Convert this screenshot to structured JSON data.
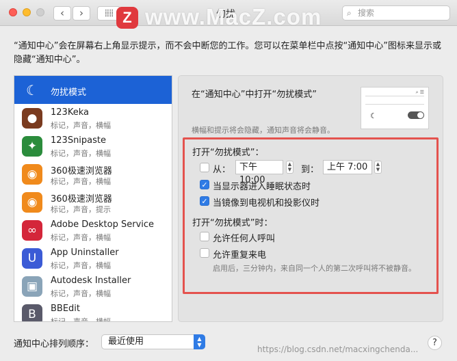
{
  "window": {
    "title": "勿扰"
  },
  "toolbar": {
    "back_icon": "chevron-left-icon",
    "forward_icon": "chevron-right-icon",
    "grid_icon": "show-all-grid-icon"
  },
  "search": {
    "placeholder": "搜索"
  },
  "watermark": {
    "logo_letter": "Z",
    "site": "www.MacZ.com",
    "url": "https://blog.csdn.net/macxingchenda..."
  },
  "description": "“通知中心”会在屏幕右上角显示提示，而不会中断您的工作。您可以在菜单栏中点按“通知中心”图标来显示或隐藏“通知中心”。",
  "apps": [
    {
      "name": "勿扰模式",
      "sub": "",
      "icon": "moon-icon",
      "color": "#1a1f6b",
      "selected": true
    },
    {
      "name": "123Keka",
      "sub": "标记，声音，横幅",
      "icon": "keka-icon",
      "color": "#7a3b1f"
    },
    {
      "name": "123Snipaste",
      "sub": "标记，声音，横幅",
      "icon": "snipaste-icon",
      "color": "#2b8c3c"
    },
    {
      "name": "360极速浏览器",
      "sub": "标记，声音，横幅",
      "icon": "360-browser-icon",
      "color": "#f08a1c"
    },
    {
      "name": "360极速浏览器",
      "sub": "标记，声音，提示",
      "icon": "360-browser-icon",
      "color": "#f08a1c"
    },
    {
      "name": "Adobe Desktop Service",
      "sub": "标记，声音，横幅",
      "icon": "adobe-cc-icon",
      "color": "#d4263a"
    },
    {
      "name": "App Uninstaller",
      "sub": "标记，声音，横幅",
      "icon": "magnet-icon",
      "color": "#3b5bd6"
    },
    {
      "name": "Autodesk Installer",
      "sub": "标记，声音，横幅",
      "icon": "autodesk-box-icon",
      "color": "#8aa4b8"
    },
    {
      "name": "BBEdit",
      "sub": "标记，声音，横幅",
      "icon": "bbedit-icon",
      "color": "#5a5a6a"
    }
  ],
  "dnd": {
    "title": "在“通知中心”中打开“勿扰模式”",
    "hint": "横幅和提示将会隐藏，通知声音将会静音。",
    "turn_on_label": "打开“勿扰模式”：",
    "from_label": "从：",
    "from_time": "下午10:00",
    "to_label": "到：",
    "to_time": "上午  7:00",
    "from_checked": false,
    "sleep_label": "当显示器进入睡眠状态时",
    "sleep_checked": true,
    "mirror_label": "当镜像到电视机和投影仪时",
    "mirror_checked": true,
    "when_on_label": "打开“勿扰模式”时：",
    "allow_calls_label": "允许任何人呼叫",
    "allow_calls_checked": false,
    "repeat_calls_label": "允许重复来电",
    "repeat_calls_checked": false,
    "note": "启用后，三分钟内，来自同一个人的第二次呼叫将不被静音。"
  },
  "sort": {
    "label": "通知中心排列顺序：",
    "value": "最近使用"
  },
  "help": {
    "label": "?"
  },
  "colors": {
    "accent": "#2f7be5",
    "selection": "#1c62d6",
    "highlight_box": "#e4524e"
  }
}
